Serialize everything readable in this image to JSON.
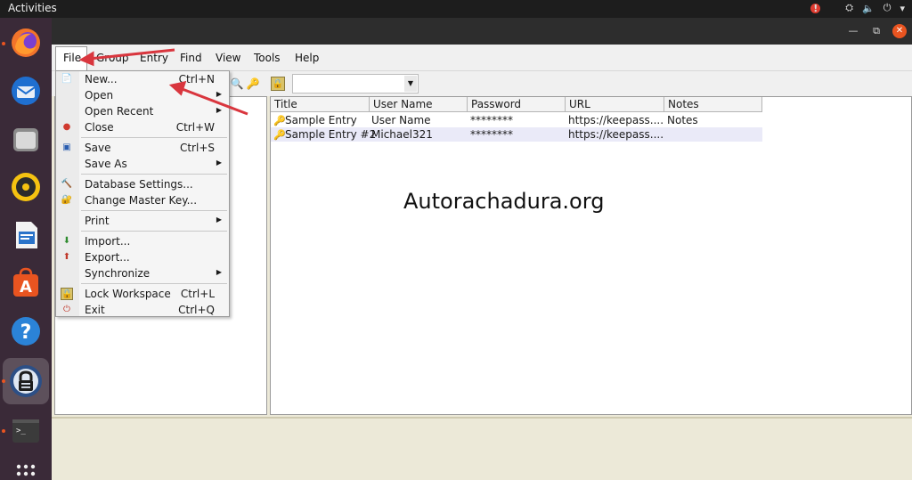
{
  "topbar": {
    "activities": "Activities",
    "alert": "!"
  },
  "menubar": {
    "file": "File",
    "group": "Group",
    "entry": "Entry",
    "find": "Find",
    "view": "View",
    "tools": "Tools",
    "help": "Help"
  },
  "file_menu": {
    "new": {
      "label": "New...",
      "shortcut": "Ctrl+N"
    },
    "open": {
      "label": "Open"
    },
    "open_recent": {
      "label": "Open Recent"
    },
    "close": {
      "label": "Close",
      "shortcut": "Ctrl+W"
    },
    "save": {
      "label": "Save",
      "shortcut": "Ctrl+S"
    },
    "save_as": {
      "label": "Save As"
    },
    "db_settings": {
      "label": "Database Settings..."
    },
    "change_key": {
      "label": "Change Master Key..."
    },
    "print": {
      "label": "Print"
    },
    "import": {
      "label": "Import..."
    },
    "export": {
      "label": "Export..."
    },
    "sync": {
      "label": "Synchronize"
    },
    "lock": {
      "label": "Lock Workspace",
      "shortcut": "Ctrl+L"
    },
    "exit": {
      "label": "Exit",
      "shortcut": "Ctrl+Q"
    }
  },
  "entries": {
    "columns": [
      "Title",
      "User Name",
      "Password",
      "URL",
      "Notes"
    ],
    "rows": [
      {
        "title": "Sample Entry",
        "user": "User Name",
        "password": "********",
        "url": "https://keepass....",
        "notes": "Notes"
      },
      {
        "title": "Sample Entry #2",
        "user": "Michael321",
        "password": "********",
        "url": "https://keepass....",
        "notes": ""
      }
    ]
  },
  "watermark": "Autorachadura.org",
  "colors": {
    "accent": "#e95420",
    "dock": "#3a2a38",
    "arrow": "#d9363e"
  }
}
